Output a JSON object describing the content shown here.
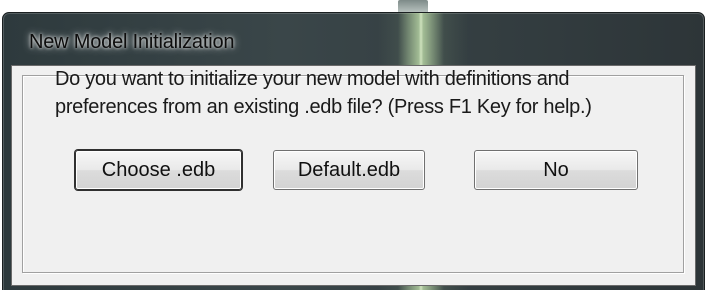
{
  "window": {
    "title": "New Model Initialization"
  },
  "dialog": {
    "message": "Do you want to initialize your new model with definitions and preferences from an existing .edb file? (Press F1 Key for help.)",
    "buttons": {
      "choose_label": "Choose .edb",
      "default_label": "Default.edb",
      "no_label": "No"
    }
  },
  "colors": {
    "frame": "#333e41",
    "client_bg": "#f0f0f0",
    "glow": "#d4ecc4"
  }
}
